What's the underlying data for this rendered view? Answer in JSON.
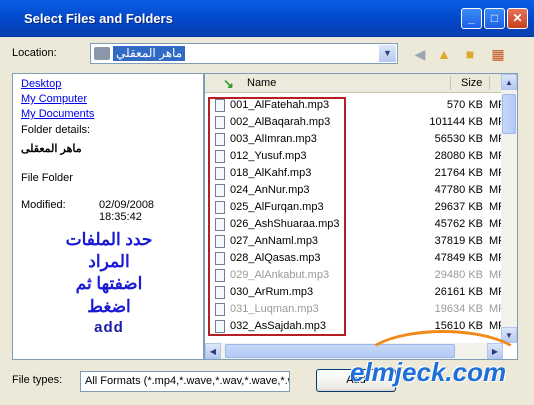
{
  "window": {
    "title": "Select Files and Folders",
    "controls": {
      "minimize": "_",
      "maximize": "□",
      "close": "✕"
    }
  },
  "location": {
    "label": "Location:",
    "value": "ماهر المعقلي"
  },
  "toolbar": {
    "icons": [
      "back-icon",
      "up-folder-icon",
      "new-folder-icon",
      "view-menu-icon"
    ]
  },
  "places": {
    "desktop": "Desktop",
    "my_computer": "My Computer",
    "my_documents": "My Documents"
  },
  "details": {
    "heading": "Folder details:",
    "folder_name": "ماهر المعقلى",
    "type": "File Folder",
    "modified_label": "Modified:",
    "modified_date": "02/09/2008",
    "modified_time": "18:35:42"
  },
  "instructions": {
    "line1": "حدد الملفات",
    "line2": "المراد",
    "line3": "اضفتها ثم",
    "line4": "اضغط",
    "line5": "add"
  },
  "file_list": {
    "columns": {
      "name": "Name",
      "size": "Size"
    },
    "rows": [
      {
        "name": "001_AlFatehah.mp3",
        "size": "570 KB",
        "type": "MP"
      },
      {
        "name": "002_AlBaqarah.mp3",
        "size": "101144 KB",
        "type": "MP"
      },
      {
        "name": "003_AlImran.mp3",
        "size": "56530 KB",
        "type": "MP"
      },
      {
        "name": "012_Yusuf.mp3",
        "size": "28080 KB",
        "type": "MP"
      },
      {
        "name": "018_AlKahf.mp3",
        "size": "21764 KB",
        "type": "MP"
      },
      {
        "name": "024_AnNur.mp3",
        "size": "47780 KB",
        "type": "MP"
      },
      {
        "name": "025_AlFurqan.mp3",
        "size": "29637 KB",
        "type": "MP"
      },
      {
        "name": "026_AshShuaraa.mp3",
        "size": "45762 KB",
        "type": "MP"
      },
      {
        "name": "027_AnNaml.mp3",
        "size": "37819 KB",
        "type": "MP"
      },
      {
        "name": "028_AlQasas.mp3",
        "size": "47849 KB",
        "type": "MP"
      },
      {
        "name": "029_AlAnkabut.mp3",
        "size": "29480 KB",
        "type": "MP"
      },
      {
        "name": "030_ArRum.mp3",
        "size": "26161 KB",
        "type": "MP"
      },
      {
        "name": "031_Luqman.mp3",
        "size": "19634 KB",
        "type": "MP"
      },
      {
        "name": "032_AsSajdah.mp3",
        "size": "15610 KB",
        "type": "MP"
      }
    ]
  },
  "file_types": {
    "label": "File types:",
    "value": "All Formats  (*.mp4,*.wave,*.wav,*.wave,*.wav"
  },
  "add_button": {
    "label": "Add"
  },
  "watermark": {
    "text": "elmjeck.com"
  },
  "colors": {
    "title_bar": "#0a5fe6",
    "selection_box": "#b51e22",
    "link": "#0000ee",
    "instruction": "#1a1ad6"
  }
}
